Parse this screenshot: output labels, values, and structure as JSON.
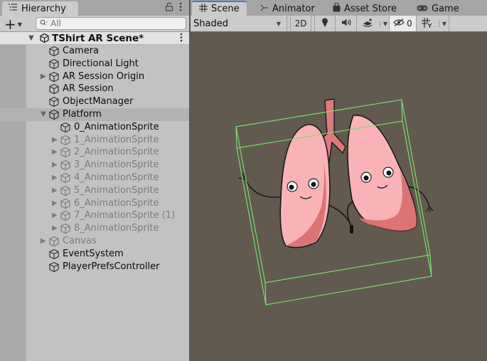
{
  "hierarchy": {
    "tab_label": "Hierarchy",
    "tab_icon": "hierarchy-list-icon",
    "lock_icon": "lock-icon",
    "menu_icon": "kebab-menu-icon",
    "add_label": "+",
    "search_placeholder": "All",
    "search_value": "",
    "scene": {
      "name": "TShirt AR Scene*",
      "expanded": true
    },
    "items": [
      {
        "label": "Camera",
        "depth": 0,
        "expandable": false,
        "expanded": false,
        "enabled": true
      },
      {
        "label": "Directional Light",
        "depth": 0,
        "expandable": false,
        "expanded": false,
        "enabled": true
      },
      {
        "label": "AR Session Origin",
        "depth": 0,
        "expandable": true,
        "expanded": false,
        "enabled": true
      },
      {
        "label": "AR Session",
        "depth": 0,
        "expandable": false,
        "expanded": false,
        "enabled": true
      },
      {
        "label": "ObjectManager",
        "depth": 0,
        "expandable": false,
        "expanded": false,
        "enabled": true
      },
      {
        "label": "Platform",
        "depth": 0,
        "expandable": true,
        "expanded": true,
        "enabled": true,
        "hover": true
      },
      {
        "label": "0_AnimationSprite",
        "depth": 1,
        "expandable": false,
        "expanded": false,
        "enabled": true
      },
      {
        "label": "1_AnimationSprite",
        "depth": 1,
        "expandable": true,
        "expanded": false,
        "enabled": false
      },
      {
        "label": "2_AnimationSprite",
        "depth": 1,
        "expandable": true,
        "expanded": false,
        "enabled": false
      },
      {
        "label": "3_AnimationSprite",
        "depth": 1,
        "expandable": true,
        "expanded": false,
        "enabled": false
      },
      {
        "label": "4_AnimationSprite",
        "depth": 1,
        "expandable": true,
        "expanded": false,
        "enabled": false
      },
      {
        "label": "5_AnimationSprite",
        "depth": 1,
        "expandable": true,
        "expanded": false,
        "enabled": false
      },
      {
        "label": "6_AnimationSprite",
        "depth": 1,
        "expandable": true,
        "expanded": false,
        "enabled": false
      },
      {
        "label": "7_AnimationSprite (1)",
        "depth": 1,
        "expandable": true,
        "expanded": false,
        "enabled": false
      },
      {
        "label": "8_AnimationSprite",
        "depth": 1,
        "expandable": true,
        "expanded": false,
        "enabled": false
      },
      {
        "label": "Canvas",
        "depth": 0,
        "expandable": true,
        "expanded": false,
        "enabled": false
      },
      {
        "label": "EventSystem",
        "depth": 0,
        "expandable": false,
        "expanded": false,
        "enabled": true
      },
      {
        "label": "PlayerPrefsController",
        "depth": 0,
        "expandable": false,
        "expanded": false,
        "enabled": true
      }
    ]
  },
  "scene_view": {
    "tabs": [
      {
        "label": "Scene",
        "icon": "grid-icon",
        "active": true
      },
      {
        "label": "Animator",
        "icon": "animator-icon",
        "active": false
      },
      {
        "label": "Asset Store",
        "icon": "shopping-bag-icon",
        "active": false
      },
      {
        "label": "Game",
        "icon": "gamepad-icon",
        "active": false
      }
    ],
    "toolbar": {
      "draw_mode": "Shaded",
      "mode_2d_label": "2D",
      "lighting_icon": "lightbulb-icon",
      "audio_icon": "speaker-icon",
      "effects_icon": "layers-effects-icon",
      "hidden_count": "0",
      "hidden_icon": "eye-hidden-icon",
      "gizmos_icon": "gizmos-grid-icon"
    },
    "content": {
      "object": "cartoon lungs sprite",
      "selection_color": "#7ddc6e",
      "background_color": "#62594f",
      "lung_color": "#f9b3b7",
      "lung_shadow_color": "#dc7375",
      "trachea_color": "#e07a7b"
    }
  },
  "colors": {
    "panel_bg": "#c2c2c2",
    "gutter_bg": "#aaaaaa",
    "tab_bar_bg": "#a5a5a5",
    "active_tab_accent": "#3a7bd5",
    "disabled_text": "#7c7c7c"
  }
}
